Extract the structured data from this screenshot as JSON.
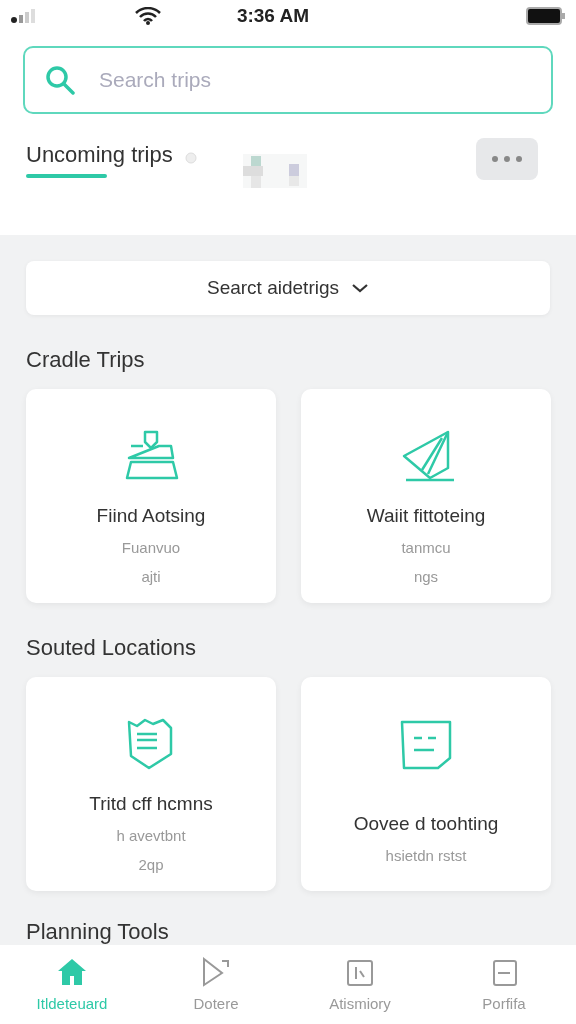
{
  "status_bar": {
    "time": "3:36 AM"
  },
  "search": {
    "placeholder": "Search trips"
  },
  "tabs": [
    {
      "label": "Uncoming trips",
      "selected": true
    }
  ],
  "filter": {
    "label": "Searct aidetrigs"
  },
  "sections": [
    {
      "title": "Cradle Trips",
      "cards": [
        {
          "kind": "map",
          "title": "Fiind Aotsing",
          "lines": [
            "Fuanvuo",
            "ajti"
          ]
        },
        {
          "kind": "sail",
          "title": "Waiit fittoteing",
          "lines": [
            "tanmcu",
            "ngs"
          ]
        }
      ]
    },
    {
      "title": "Souted Locations",
      "cards": [
        {
          "kind": "mask",
          "title": "Tritd cff hcmns",
          "lines": [
            "h avevtbnt",
            "2qp"
          ]
        },
        {
          "kind": "note",
          "title": "Oovee d toohting",
          "lines": [
            "hsietdn rstst"
          ]
        }
      ]
    }
  ],
  "planning_title": "Planning Tools",
  "nav": [
    {
      "kind": "home",
      "label": "Itldeteuard",
      "selected": true
    },
    {
      "kind": "play",
      "label": "Dotere",
      "selected": false
    },
    {
      "kind": "clipboard",
      "label": "Atismiory",
      "selected": false
    },
    {
      "kind": "book",
      "label": "Porfifa",
      "selected": false
    }
  ]
}
